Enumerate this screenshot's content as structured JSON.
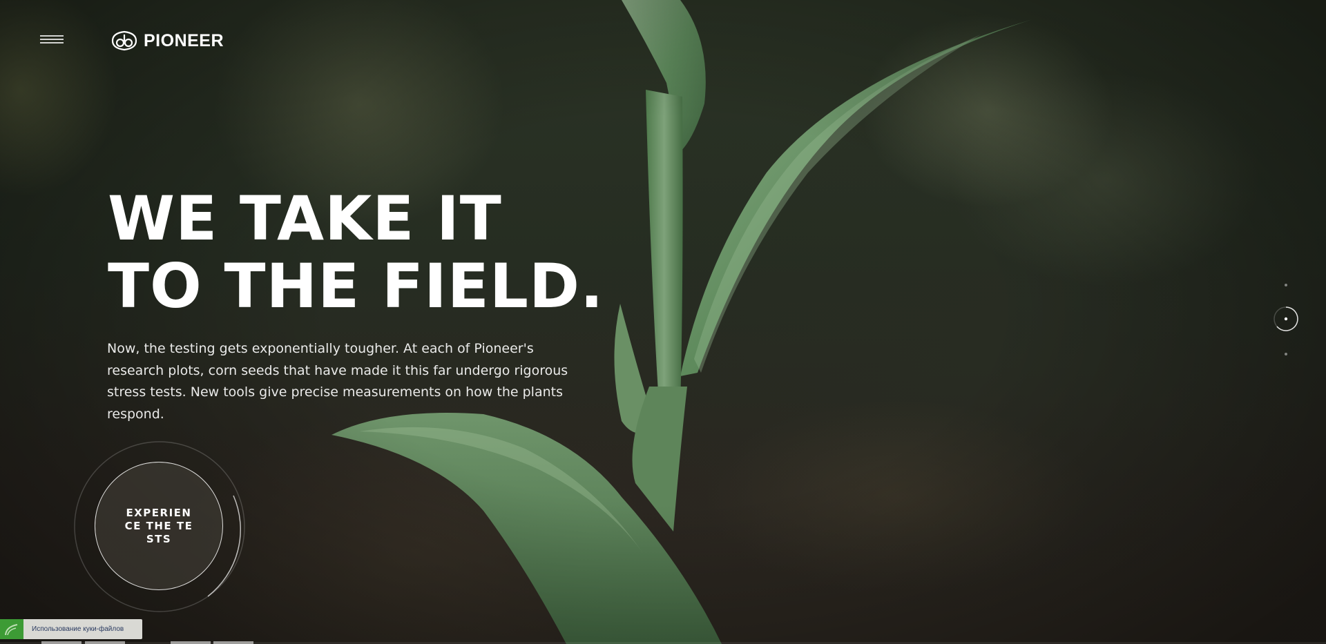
{
  "header": {
    "menu_icon": "hamburger-menu-icon",
    "logo_icon": "pioneer-seed-logo-icon",
    "logo_text": "PIONEER"
  },
  "hero": {
    "headline": "WE TAKE IT TO THE FIELD.",
    "body": "Now, the testing gets exponentially tougher. At each of Pioneer's research plots, corn seeds that have made it this far undergo rigorous stress tests. New tools give precise measurements on how the plants respond.",
    "cta_label": "EXPERIENCE THE TESTS"
  },
  "pager": {
    "total": 3,
    "active_index": 2
  },
  "cookie": {
    "label": "Использование куки-файлов",
    "icon": "cookie-leaf-icon"
  },
  "colors": {
    "background": "#262d22",
    "text": "#ffffff",
    "cookie_accent": "#3d9b35",
    "cookie_bg": "#d9d9d4"
  }
}
